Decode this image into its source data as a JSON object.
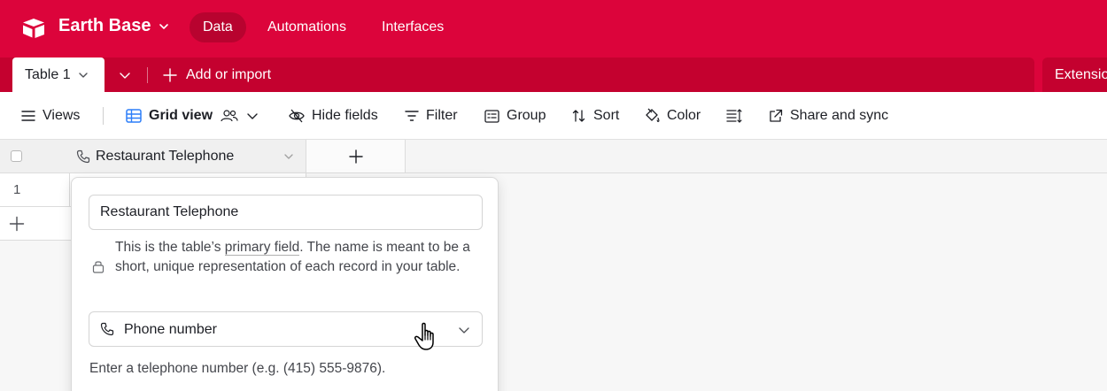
{
  "app": {
    "base_name": "Earth Base",
    "brand_color": "#dc043b",
    "nav": [
      {
        "label": "Data",
        "active": true
      },
      {
        "label": "Automations",
        "active": false
      },
      {
        "label": "Interfaces",
        "active": false
      }
    ]
  },
  "tabs": {
    "active_table": "Table 1",
    "add_import_label": "Add or import",
    "extensions_label": "Extensio"
  },
  "toolbar": {
    "views_label": "Views",
    "grid_view_label": "Grid view",
    "hide_fields_label": "Hide fields",
    "filter_label": "Filter",
    "group_label": "Group",
    "sort_label": "Sort",
    "color_label": "Color",
    "share_label": "Share and sync"
  },
  "grid": {
    "primary_field_name": "Restaurant Telephone",
    "rows": [
      {
        "number": "1"
      }
    ]
  },
  "field_editor": {
    "field_name_value": "Restaurant Telephone",
    "primary_note_before": "This is the table’s ",
    "primary_note_link": "primary field",
    "primary_note_after": ". The name is meant to be a short, unique representation of each record in your table.",
    "field_type_label": "Phone number",
    "field_type_description": "Enter a telephone number (e.g. (415) 555-9876)."
  }
}
